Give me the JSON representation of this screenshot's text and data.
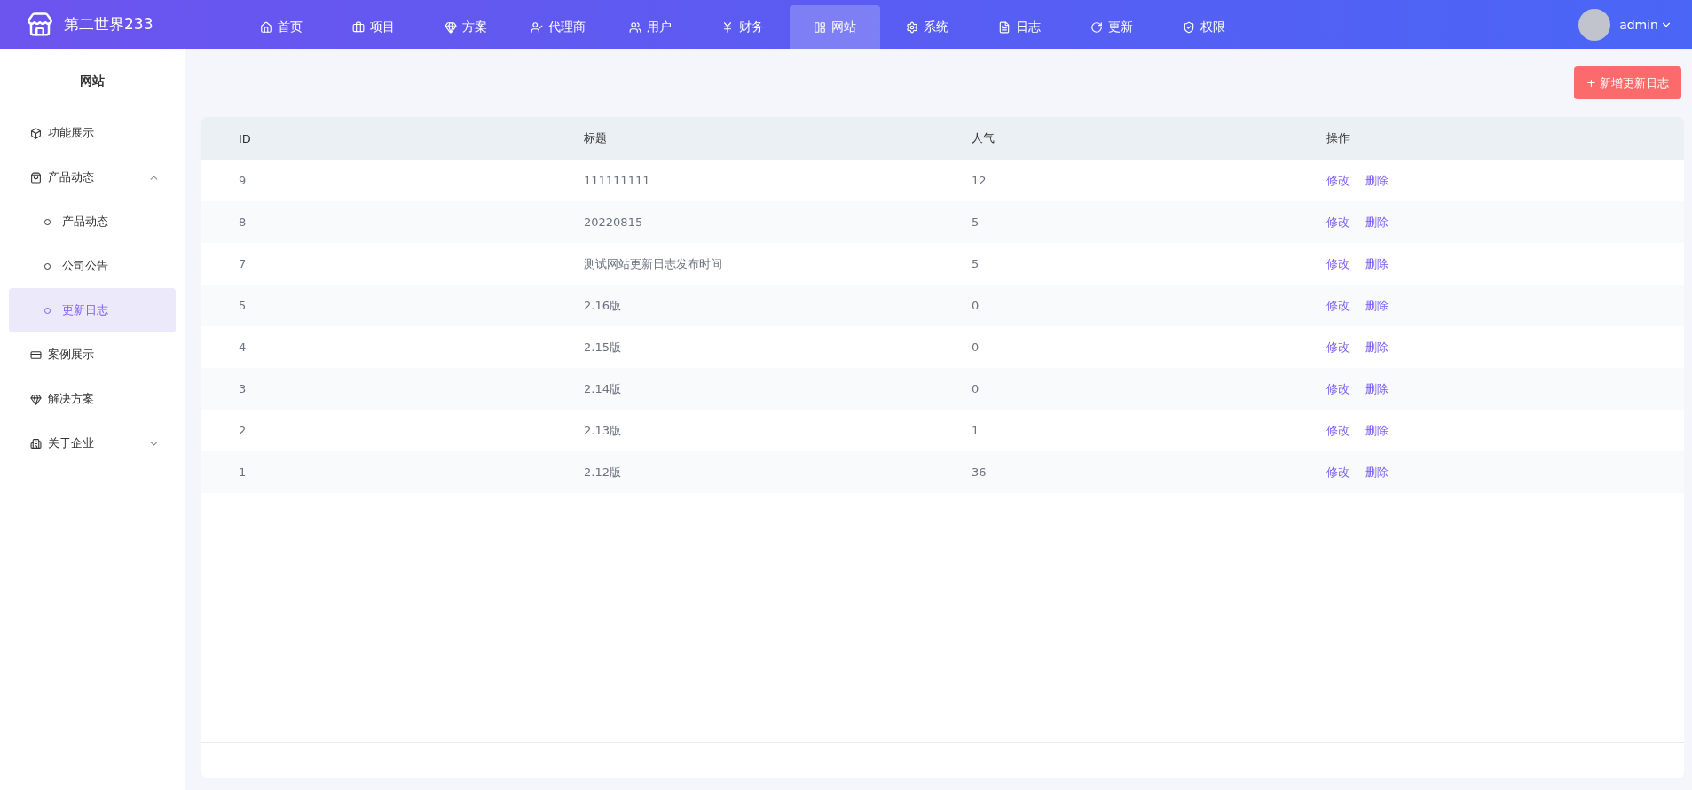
{
  "brand": {
    "name": "第二世界233"
  },
  "nav": [
    {
      "label": "首页",
      "selected": false
    },
    {
      "label": "项目",
      "selected": false
    },
    {
      "label": "方案",
      "selected": false
    },
    {
      "label": "代理商",
      "selected": false
    },
    {
      "label": "用户",
      "selected": false
    },
    {
      "label": "财务",
      "selected": false
    },
    {
      "label": "网站",
      "selected": true
    },
    {
      "label": "系统",
      "selected": false
    },
    {
      "label": "日志",
      "selected": false
    },
    {
      "label": "更新",
      "selected": false
    },
    {
      "label": "权限",
      "selected": false
    }
  ],
  "user": {
    "name": "admin"
  },
  "sidebar": {
    "title": "网站",
    "items": [
      {
        "label": "功能展示",
        "selected": false
      },
      {
        "label": "产品动态",
        "selected": false,
        "expanded": true,
        "children": [
          {
            "label": "产品动态",
            "selected": false
          },
          {
            "label": "公司公告",
            "selected": false
          },
          {
            "label": "更新日志",
            "selected": true
          }
        ]
      },
      {
        "label": "案例展示",
        "selected": false
      },
      {
        "label": "解决方案",
        "selected": false
      },
      {
        "label": "关于企业",
        "selected": false,
        "expanded": false
      }
    ]
  },
  "add_button": "+ 新增更新日志",
  "table": {
    "columns": [
      "ID",
      "标题",
      "人气",
      "操作"
    ],
    "rows": [
      {
        "id": "9",
        "title": "111111111",
        "views": "12",
        "actions": [
          "修改",
          "删除"
        ]
      },
      {
        "id": "8",
        "title": "20220815",
        "views": "5",
        "actions": [
          "修改",
          "删除"
        ]
      },
      {
        "id": "7",
        "title": "测试网站更新日志发布时间",
        "views": "5",
        "actions": [
          "修改",
          "删除"
        ]
      },
      {
        "id": "5",
        "title": "2.16版",
        "views": "0",
        "actions": [
          "修改",
          "删除"
        ]
      },
      {
        "id": "4",
        "title": "2.15版",
        "views": "0",
        "actions": [
          "修改",
          "删除"
        ]
      },
      {
        "id": "3",
        "title": "2.14版",
        "views": "0",
        "actions": [
          "修改",
          "删除"
        ]
      },
      {
        "id": "2",
        "title": "2.13版",
        "views": "1",
        "actions": [
          "修改",
          "删除"
        ]
      },
      {
        "id": "1",
        "title": "2.12版",
        "views": "36",
        "actions": [
          "修改",
          "删除"
        ]
      }
    ]
  }
}
